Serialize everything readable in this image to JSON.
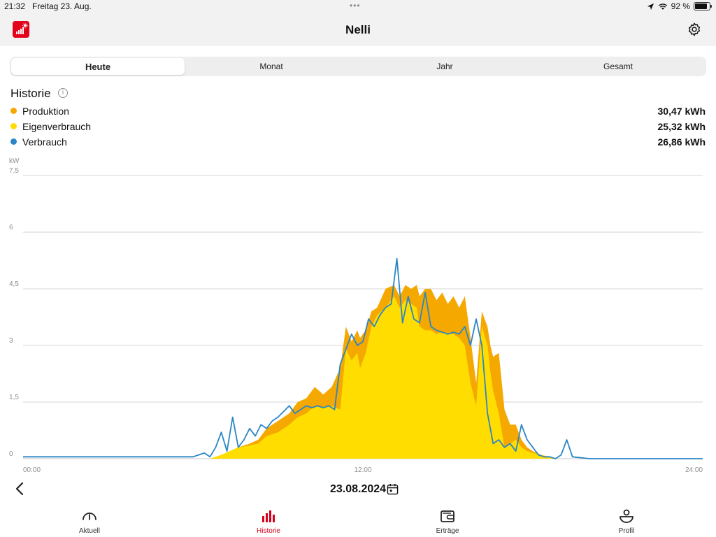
{
  "status": {
    "time": "21:32",
    "date": "Freitag 23. Aug.",
    "battery": "92 %"
  },
  "nav": {
    "title": "Nelli"
  },
  "segments": [
    "Heute",
    "Monat",
    "Jahr",
    "Gesamt"
  ],
  "section": {
    "title": "Historie",
    "info": "i"
  },
  "legend": [
    {
      "label": "Produktion",
      "value": "30,47 kWh",
      "color": "#f5a800"
    },
    {
      "label": "Eigenverbrauch",
      "value": "25,32 kWh",
      "color": "#ffdd00"
    },
    {
      "label": "Verbrauch",
      "value": "26,86 kWh",
      "color": "#2b86c5"
    }
  ],
  "chart_data": {
    "type": "area",
    "unit": "kW",
    "ylim": [
      0,
      7.5
    ],
    "yticks": [
      "0",
      "1,5",
      "3",
      "4,5",
      "6",
      "7,5"
    ],
    "xticks": [
      "00:00",
      "12:00",
      "24:00"
    ],
    "xlim_hours": [
      0,
      24
    ],
    "grid": true,
    "series": [
      {
        "name": "Produktion",
        "color": "#f5a800",
        "x": [
          6.6,
          7.0,
          7.3,
          7.6,
          8.0,
          8.3,
          8.6,
          9.0,
          9.4,
          9.7,
          10.0,
          10.3,
          10.6,
          10.9,
          11.2,
          11.4,
          11.6,
          11.8,
          11.9,
          12.1,
          12.3,
          12.5,
          12.8,
          13.1,
          13.3,
          13.5,
          13.7,
          13.9,
          14.0,
          14.2,
          14.4,
          14.6,
          14.8,
          15.0,
          15.2,
          15.4,
          15.6,
          15.8,
          16.0,
          16.2,
          16.4,
          16.5,
          16.6,
          16.8,
          17.0,
          17.2,
          17.4,
          17.6,
          17.8,
          18.0,
          18.3,
          18.6,
          18.9,
          19.2,
          19.4
        ],
        "y": [
          0.0,
          0.1,
          0.2,
          0.3,
          0.4,
          0.5,
          0.8,
          1.0,
          1.2,
          1.5,
          1.6,
          1.9,
          1.7,
          1.9,
          2.4,
          3.5,
          3.1,
          3.4,
          3.2,
          3.4,
          3.9,
          4.0,
          4.5,
          4.6,
          4.3,
          4.6,
          4.5,
          4.6,
          4.3,
          4.5,
          4.5,
          4.2,
          4.4,
          4.1,
          4.3,
          4.0,
          4.3,
          3.2,
          2.0,
          3.9,
          3.5,
          3.0,
          2.7,
          2.8,
          1.3,
          0.9,
          0.9,
          0.5,
          0.3,
          0.2,
          0.1,
          0.05,
          0.0,
          0.0,
          0.0
        ]
      },
      {
        "name": "Eigenverbrauch",
        "color": "#ffdd00",
        "x": [
          6.6,
          7.0,
          7.3,
          7.6,
          8.0,
          8.3,
          8.6,
          9.0,
          9.4,
          9.7,
          10.0,
          10.3,
          10.6,
          10.9,
          11.2,
          11.4,
          11.6,
          11.8,
          11.9,
          12.1,
          12.3,
          12.5,
          12.8,
          13.1,
          13.3,
          13.5,
          13.7,
          13.9,
          14.0,
          14.2,
          14.4,
          14.6,
          14.8,
          15.0,
          15.2,
          15.4,
          15.6,
          15.8,
          16.0,
          16.2,
          16.4,
          16.5,
          16.6,
          16.8,
          17.0,
          17.2,
          17.4,
          17.6,
          17.8,
          18.0,
          18.3,
          18.6,
          18.9,
          19.2,
          19.4
        ],
        "y": [
          0.0,
          0.1,
          0.2,
          0.3,
          0.35,
          0.4,
          0.6,
          0.7,
          0.9,
          1.1,
          1.2,
          1.4,
          1.35,
          1.4,
          1.3,
          2.9,
          2.6,
          2.8,
          2.4,
          2.8,
          3.5,
          3.8,
          4.0,
          4.3,
          4.0,
          4.2,
          4.1,
          4.0,
          3.5,
          3.4,
          3.4,
          3.3,
          3.35,
          3.3,
          3.3,
          3.2,
          3.0,
          2.0,
          1.4,
          3.5,
          3.0,
          2.3,
          1.8,
          1.2,
          0.3,
          0.4,
          0.5,
          0.3,
          0.2,
          0.15,
          0.1,
          0.05,
          0.0,
          0.0,
          0.0
        ]
      },
      {
        "name": "Verbrauch",
        "color": "#2b86c5",
        "x": [
          0.0,
          1.0,
          2.0,
          3.0,
          4.0,
          5.0,
          6.0,
          6.2,
          6.4,
          6.6,
          6.8,
          7.0,
          7.2,
          7.4,
          7.6,
          7.8,
          8.0,
          8.2,
          8.4,
          8.6,
          8.8,
          9.0,
          9.4,
          9.6,
          9.8,
          10.0,
          10.2,
          10.4,
          10.6,
          10.8,
          11.0,
          11.2,
          11.4,
          11.6,
          11.8,
          12.0,
          12.2,
          12.4,
          12.6,
          12.8,
          13.0,
          13.2,
          13.4,
          13.6,
          13.8,
          14.0,
          14.2,
          14.4,
          14.6,
          14.8,
          15.0,
          15.2,
          15.4,
          15.6,
          15.8,
          16.0,
          16.2,
          16.4,
          16.6,
          16.8,
          17.0,
          17.2,
          17.4,
          17.6,
          17.8,
          18.0,
          18.2,
          18.4,
          18.6,
          18.8,
          19.0,
          19.2,
          19.4,
          20.0,
          21.0,
          22.0,
          23.0,
          24.0
        ],
        "y": [
          0.05,
          0.05,
          0.05,
          0.05,
          0.05,
          0.05,
          0.05,
          0.1,
          0.15,
          0.05,
          0.3,
          0.7,
          0.2,
          1.1,
          0.3,
          0.5,
          0.8,
          0.6,
          0.9,
          0.8,
          1.0,
          1.1,
          1.4,
          1.2,
          1.3,
          1.4,
          1.35,
          1.4,
          1.35,
          1.4,
          1.3,
          2.5,
          2.9,
          3.3,
          3.0,
          3.1,
          3.7,
          3.5,
          3.8,
          4.0,
          4.1,
          5.3,
          3.6,
          4.3,
          3.7,
          3.6,
          4.4,
          3.5,
          3.4,
          3.35,
          3.3,
          3.35,
          3.3,
          3.5,
          3.0,
          3.7,
          3.0,
          1.2,
          0.4,
          0.5,
          0.3,
          0.4,
          0.2,
          0.9,
          0.5,
          0.3,
          0.1,
          0.05,
          0.05,
          0.0,
          0.1,
          0.5,
          0.05,
          0.0,
          0.0,
          0.0,
          0.0,
          0.0
        ]
      }
    ]
  },
  "footer": {
    "date": "23.08.2024"
  },
  "tabbar": [
    {
      "label": "Aktuell",
      "icon": "gauge-icon",
      "active": false
    },
    {
      "label": "Historie",
      "icon": "bar-chart-icon",
      "active": true
    },
    {
      "label": "Erträge",
      "icon": "wallet-icon",
      "active": false
    },
    {
      "label": "Profil",
      "icon": "profile-icon",
      "active": false
    }
  ]
}
